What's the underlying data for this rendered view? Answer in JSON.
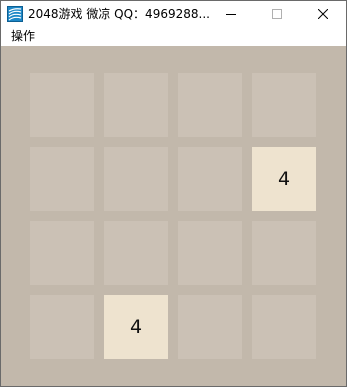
{
  "window": {
    "title": "2048游戏 微凉 QQ：4969288...",
    "icon": "app-icon"
  },
  "menu": {
    "items": [
      {
        "label": "操作"
      }
    ]
  },
  "board": {
    "size": 4,
    "tiles": [
      [
        "",
        "",
        "",
        ""
      ],
      [
        "",
        "",
        "",
        "4"
      ],
      [
        "",
        "",
        "",
        ""
      ],
      [
        "",
        "4",
        "",
        ""
      ]
    ]
  },
  "colors": {
    "board_background": "#c2b8ab",
    "empty_tile": "#cbc1b5",
    "tile_4": "#eee3cf"
  }
}
